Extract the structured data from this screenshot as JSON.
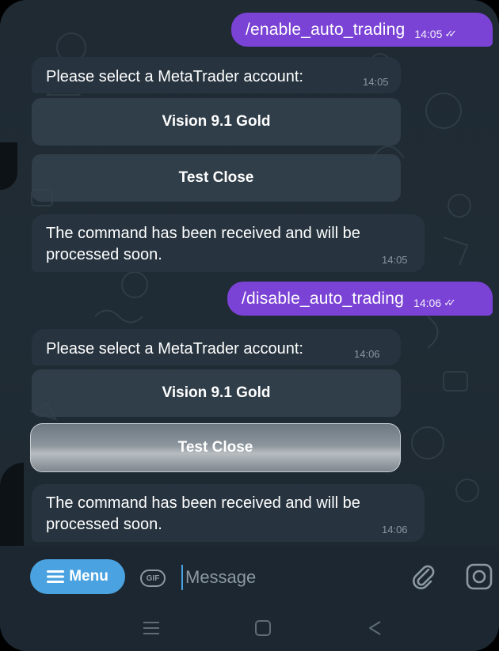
{
  "messages": [
    {
      "type": "out",
      "text": "/enable_auto_trading",
      "time": "14:05",
      "ticks": "✓✓"
    },
    {
      "type": "in",
      "text": "Please select a MetaTrader account:",
      "time": "14:05"
    },
    {
      "type": "in",
      "text_lines": [
        "The command has been received and will be",
        "processed soon."
      ],
      "time": "14:05"
    },
    {
      "type": "out",
      "text": "/disable_auto_trading",
      "time": "14:06",
      "ticks": "✓✓"
    },
    {
      "type": "in",
      "text": "Please select a MetaTrader account:",
      "time": "14:06"
    },
    {
      "type": "in",
      "text_lines": [
        "The command has been received and will be",
        "processed soon."
      ],
      "time": "14:06"
    }
  ],
  "keyboards": [
    {
      "buttons": [
        "Vision 9.1 Gold",
        "Test Close"
      ]
    },
    {
      "buttons": [
        "Vision 9.1 Gold",
        "Test Close"
      ],
      "pressed_button": "Test Close"
    }
  ],
  "input_bar": {
    "menu_label": "Menu",
    "gif_label": "GIF",
    "placeholder": "Message"
  },
  "colors": {
    "outgoing_bubble": "#7a43d6",
    "incoming_bubble": "#27343f",
    "menu_button": "#4aa3e0",
    "background": "#202c35"
  },
  "icons": [
    "menu-hamburger-icon",
    "gif-icon",
    "attach-paperclip-icon",
    "camera-icon",
    "nav-recents-icon",
    "nav-home-icon",
    "nav-back-icon",
    "read-double-check-icon"
  ]
}
